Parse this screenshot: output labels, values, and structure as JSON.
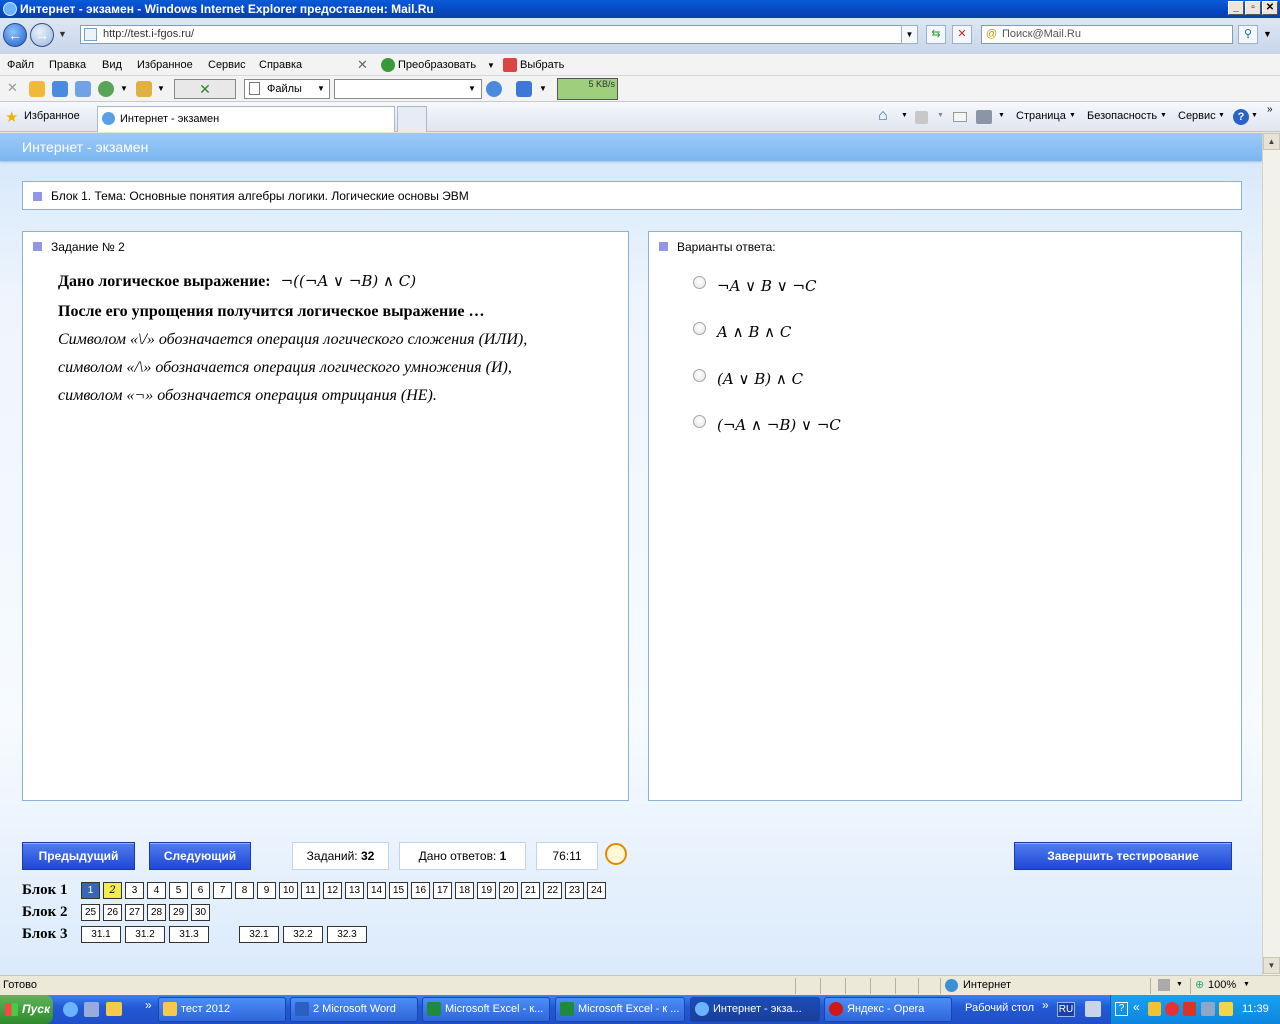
{
  "window": {
    "title": "Интернет - экзамен - Windows Internet Explorer предоставлен: Mail.Ru"
  },
  "address": {
    "url": "http://test.i-fgos.ru/",
    "search_placeholder": "Поиск@Mail.Ru"
  },
  "menu": [
    "Файл",
    "Правка",
    "Вид",
    "Избранное",
    "Сервис",
    "Справка"
  ],
  "toolbar": {
    "convert": "Преобразовать",
    "select": "Выбрать",
    "files": "Файлы",
    "speed": "5 KB/s"
  },
  "favbar": {
    "favorites": "Избранное",
    "tab": "Интернет - экзамен",
    "page": "Страница",
    "security": "Безопасность",
    "service": "Сервис"
  },
  "page": {
    "header": "Интернет - экзамен",
    "block_title": "Блок 1. Тема: Основные понятия алгебры логики. Логические основы ЭВМ"
  },
  "question": {
    "heading": "Задание № 2",
    "line1_label": "Дано логическое выражение:",
    "line1_expr": "¬((¬A ∨ ¬B) ∧ C)",
    "line2": "После его упрощения получится логическое выражение …",
    "line3": "Символом «\\/» обозначается операция логического сложения (ИЛИ),",
    "line4": "символом «/\\» обозначается операция логического умножения (И),",
    "line5": "символом «¬» обозначается операция отрицания (НЕ)."
  },
  "answers": {
    "heading": "Варианты ответа:",
    "options": [
      "¬A ∨ B ∨ ¬C",
      "A ∧ B ∧ C",
      "(A ∨ B) ∧ C",
      "(¬A ∧ ¬B) ∨ ¬C"
    ]
  },
  "controls": {
    "prev": "Предыдущий",
    "next": "Следующий",
    "tasks_label": "Заданий:",
    "tasks_value": "32",
    "answered_label": "Дано ответов:",
    "answered_value": "1",
    "timer": "76:11",
    "finish": "Завершить тестирование"
  },
  "blocks": [
    {
      "label": "Блок 1",
      "items": [
        "1",
        "2",
        "3",
        "4",
        "5",
        "6",
        "7",
        "8",
        "9",
        "10",
        "11",
        "12",
        "13",
        "14",
        "15",
        "16",
        "17",
        "18",
        "19",
        "20",
        "21",
        "22",
        "23",
        "24"
      ]
    },
    {
      "label": "Блок 2",
      "items": [
        "25",
        "26",
        "27",
        "28",
        "29",
        "30"
      ]
    },
    {
      "label": "Блок 3",
      "items": [
        "31.1",
        "31.2",
        "31.3",
        "32.1",
        "32.2",
        "32.3"
      ]
    }
  ],
  "status": {
    "text": "Готово",
    "zone": "Интернет",
    "zoom": "100%"
  },
  "taskbar": {
    "start": "Пуск",
    "tasks": [
      "тест 2012",
      "2 Microsoft Word",
      "Microsoft Excel - к...",
      "Microsoft Excel - к ...",
      "Интернет - экза...",
      "Яндекс - Opera"
    ],
    "desktop": "Рабочий стол",
    "lang": "RU",
    "clock": "11:39"
  }
}
